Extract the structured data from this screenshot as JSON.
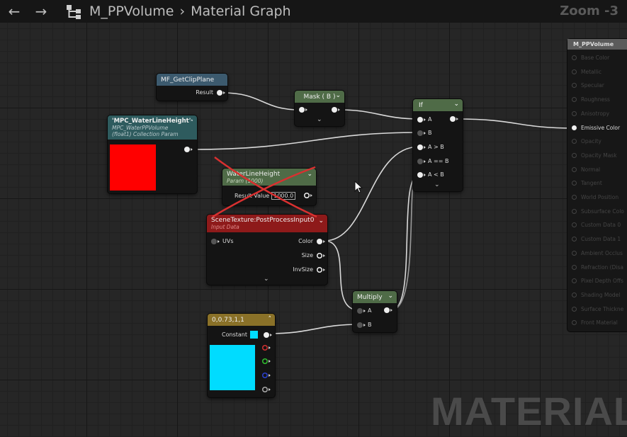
{
  "toolbar": {
    "back_icon": "back-arrow-icon",
    "forward_icon": "forward-arrow-icon",
    "breadcrumb": [
      "M_PPVolume",
      "Material Graph"
    ],
    "zoom": "Zoom -3"
  },
  "nodes": {
    "mf_getclipplane": {
      "title": "MF_GetClipPlane",
      "output": "Result"
    },
    "mask": {
      "title": "Mask ( B )"
    },
    "mpc": {
      "title": "'MPC_WaterLineHeight'",
      "subtitle1": "MPC_WaterPPVolume",
      "subtitle2": "(float1) Collection Param",
      "preview_color": "#ff0000"
    },
    "waterline": {
      "title": "WaterLineHeight",
      "subtitle": "Param (1000)",
      "label": "Result Value",
      "value": "1000.0"
    },
    "scenetexture": {
      "title": "SceneTexture:PostProcessInput0",
      "subtitle": "Input Data",
      "input": "UVs",
      "outputs": [
        "Color",
        "Size",
        "InvSize"
      ]
    },
    "if": {
      "title": "If",
      "inputs": [
        "A",
        "B",
        "A > B",
        "A == B",
        "A < B"
      ]
    },
    "multiply": {
      "title": "Multiply",
      "inputs": [
        "A",
        "B"
      ]
    },
    "constant": {
      "title": "0,0.73,1,1",
      "label": "Constant",
      "preview_color": "#00dcff"
    }
  },
  "result_node": {
    "title": "M_PPVolume",
    "pins": [
      "Base Color",
      "Metallic",
      "Specular",
      "Roughness",
      "Anisotropy",
      "Emissive Color",
      "Opacity",
      "Opacity Mask",
      "Normal",
      "Tangent",
      "World Position",
      "Subsurface Colo",
      "Custom Data 0",
      "Custom Data 1",
      "Ambient Occlus",
      "Refraction (Disa",
      "Pixel Depth Offs",
      "Shading Model",
      "Surface Thickne",
      "Front Material"
    ],
    "active_pin": "Emissive Color"
  },
  "watermark": "MATERIAL",
  "colors": {
    "header_blue": "#3c5a6e",
    "header_green": "#4f6b47",
    "header_teal": "#2e5b5e",
    "header_red": "#8e1a1a",
    "header_gold": "#8a7128",
    "cross": "#d93030"
  }
}
